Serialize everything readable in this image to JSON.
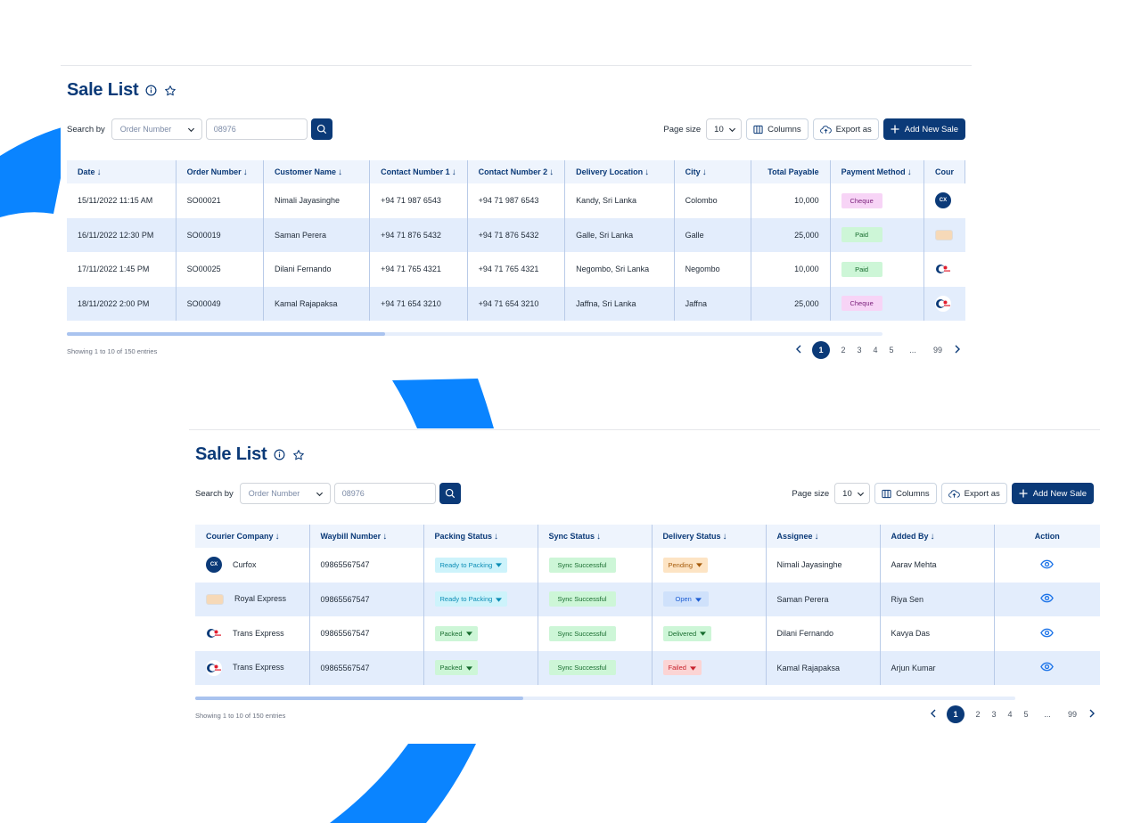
{
  "colors": {
    "primary": "#0b3a78",
    "accent_blue": "#0a84ff"
  },
  "panel1": {
    "title": "Sale List",
    "search": {
      "label": "Search by",
      "field": "Order Number",
      "value": "08976"
    },
    "page_size": {
      "label": "Page size",
      "value": "10"
    },
    "columns_label": "Columns",
    "export_label": "Export as",
    "add_label": "Add New Sale",
    "headers": [
      "Date",
      "Order Number",
      "Customer Name",
      "Contact Number 1",
      "Contact Number 2",
      "Delivery Location",
      "City",
      "Total Payable",
      "Payment Method",
      "Cour"
    ],
    "rows": [
      {
        "date": "15/11/2022 11:15 AM",
        "order": "SO00021",
        "customer": "Nimali Jayasinghe",
        "c1": "+94 71 987 6543",
        "c2": "+94 71 987 6543",
        "location": "Kandy, Sri Lanka",
        "city": "Colombo",
        "total": "10,000",
        "payment": "Cheque",
        "courier_icon": "curfox-logo"
      },
      {
        "date": "16/11/2022 12:30 PM",
        "order": "SO00019",
        "customer": "Saman Perera",
        "c1": "+94 71 876 5432",
        "c2": "+94 71 876 5432",
        "location": "Galle, Sri Lanka",
        "city": "Galle",
        "total": "25,000",
        "payment": "Paid",
        "courier_icon": "royal-express-logo"
      },
      {
        "date": "17/11/2022 1:45 PM",
        "order": "SO00025",
        "customer": "Dilani Fernando",
        "c1": "+94 71 765 4321",
        "c2": "+94 71 765 4321",
        "location": "Negombo, Sri Lanka",
        "city": "Negombo",
        "total": "10,000",
        "payment": "Paid",
        "courier_icon": "trans-express-logo"
      },
      {
        "date": "18/11/2022 2:00 PM",
        "order": "SO00049",
        "customer": "Kamal Rajapaksa",
        "c1": "+94 71 654 3210",
        "c2": "+94 71 654 3210",
        "location": "Jaffna, Sri Lanka",
        "city": "Jaffna",
        "total": "25,000",
        "payment": "Cheque",
        "courier_icon": "trans-express-logo"
      }
    ],
    "showing": "Showing 1 to 10 of 150 entries",
    "pages": [
      "1",
      "2",
      "3",
      "4",
      "5",
      "...",
      "99"
    ],
    "scroll_fraction": 0.39
  },
  "panel2": {
    "title": "Sale List",
    "search": {
      "label": "Search by",
      "field": "Order Number",
      "value": "08976"
    },
    "page_size": {
      "label": "Page size",
      "value": "10"
    },
    "columns_label": "Columns",
    "export_label": "Export as",
    "add_label": "Add New Sale",
    "headers": [
      "Courier Company",
      "Waybill Number",
      "Packing Status",
      "Sync Status",
      "Delivery Status",
      "Assignee",
      "Added By",
      "Action"
    ],
    "rows": [
      {
        "courier": "Curfox",
        "courier_icon": "curfox-logo",
        "waybill": "09865567547",
        "packing": "Ready to Packing",
        "sync": "Sync Successful",
        "delivery": "Pending",
        "assignee": "Nimali Jayasinghe",
        "added_by": "Aarav Mehta"
      },
      {
        "courier": "Royal Express",
        "courier_icon": "royal-express-logo",
        "waybill": "09865567547",
        "packing": "Ready to Packing",
        "sync": "Sync Successful",
        "delivery": "Open",
        "assignee": "Saman Perera",
        "added_by": "Riya Sen"
      },
      {
        "courier": "Trans Express",
        "courier_icon": "trans-express-logo",
        "waybill": "09865567547",
        "packing": "Packed",
        "sync": "Sync Successful",
        "delivery": "Delivered",
        "assignee": "Dilani Fernando",
        "added_by": "Kavya Das"
      },
      {
        "courier": "Trans Express",
        "courier_icon": "trans-express-logo",
        "waybill": "09865567547",
        "packing": "Packed",
        "sync": "Sync Successful",
        "delivery": "Failed",
        "assignee": "Kamal Rajapaksa",
        "added_by": "Arjun Kumar"
      }
    ],
    "showing": "Showing 1 to 10 of 150 entries",
    "pages": [
      "1",
      "2",
      "3",
      "4",
      "5",
      "...",
      "99"
    ],
    "scroll_fraction": 0.4
  }
}
